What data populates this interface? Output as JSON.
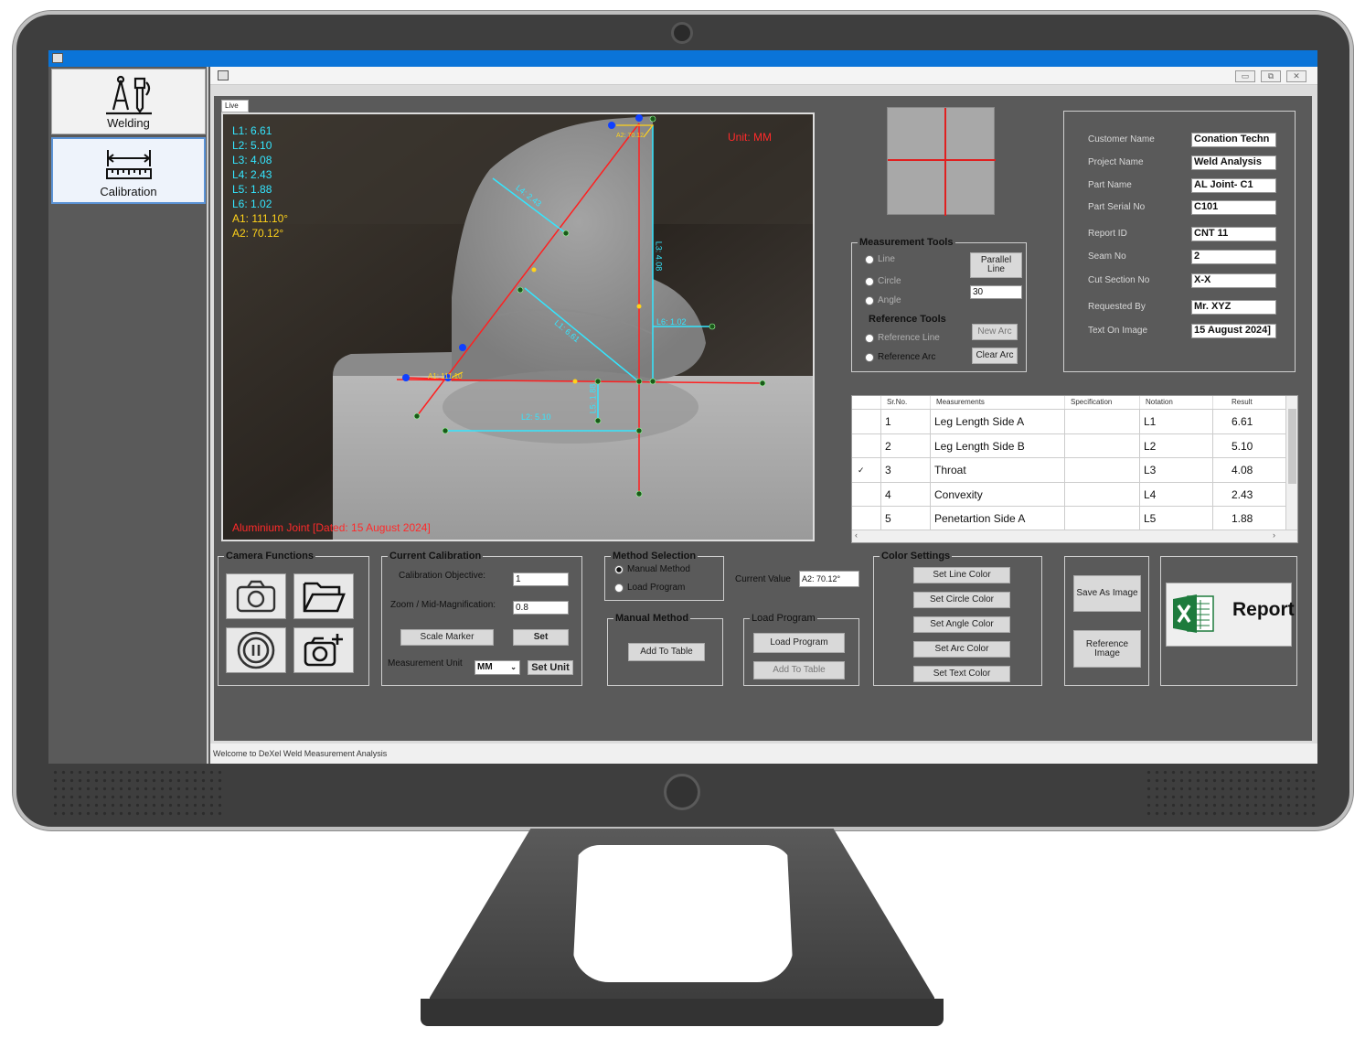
{
  "sidebar": {
    "items": [
      {
        "label": "Welding"
      },
      {
        "label": "Calibration"
      }
    ]
  },
  "window": {
    "live_tab": "Live",
    "status": "Welcome to DeXel Weld Measurement Analysis"
  },
  "live": {
    "measurements": [
      "L1: 6.61",
      "L2: 5.10",
      "L3: 4.08",
      "L4: 2.43",
      "L5: 1.88",
      "L6: 1.02"
    ],
    "angles": [
      "A1: 111.10°",
      "A2: 70.12°"
    ],
    "unit_label": "Unit: MM",
    "caption": "Aluminium Joint [Dated: 15 August 2024]",
    "line_labels": [
      "L4: 2.43",
      "L3: 4.08",
      "L6: 1.02",
      "L2: 5.10",
      "L5: 1.88",
      "A1: 111.10",
      "A2: 70.12",
      "L1: 6.61"
    ]
  },
  "measurement_tools": {
    "title": "Measurement Tools",
    "line": "Line",
    "circle": "Circle",
    "angle": "Angle",
    "parallel_line": "Parallel Line",
    "parallel_value": "30",
    "reference_title": "Reference Tools",
    "reference_line": "Reference Line",
    "reference_arc": "Reference Arc",
    "new_arc": "New Arc",
    "clear_arc": "Clear Arc"
  },
  "info": {
    "fields": [
      {
        "label": "Customer Name",
        "value": "Conation Techn"
      },
      {
        "label": "Project Name",
        "value": "Weld Analysis"
      },
      {
        "label": "Part Name",
        "value": "AL Joint- C1"
      },
      {
        "label": "Part Serial No",
        "value": "C101"
      },
      {
        "label": "Report ID",
        "value": "CNT 11"
      },
      {
        "label": "Seam No",
        "value": "2"
      },
      {
        "label": "Cut Section No",
        "value": "X-X"
      },
      {
        "label": "Requested By",
        "value": "Mr. XYZ"
      },
      {
        "label": "Text On Image",
        "value": "15 August 2024]"
      }
    ]
  },
  "table": {
    "headers": [
      "Sr.No.",
      "Measurements",
      "Specification",
      "Notation",
      "Result"
    ],
    "rows": [
      {
        "sr": "1",
        "name": "Leg Length Side A",
        "spec": "",
        "notation": "L1",
        "result": "6.61"
      },
      {
        "sr": "2",
        "name": "Leg Length Side B",
        "spec": "",
        "notation": "L2",
        "result": "5.10"
      },
      {
        "sr": "3",
        "name": "Throat",
        "spec": "",
        "notation": "L3",
        "result": "4.08"
      },
      {
        "sr": "4",
        "name": "Convexity",
        "spec": "",
        "notation": "L4",
        "result": "2.43"
      },
      {
        "sr": "5",
        "name": "Penetartion Side A",
        "spec": "",
        "notation": "L5",
        "result": "1.88"
      }
    ]
  },
  "camera": {
    "title": "Camera Functions"
  },
  "calibration": {
    "title": "Current Calibration",
    "objective_label": "Calibration Objective:",
    "objective_value": "1",
    "zoom_label": "Zoom / Mid-Magnification:",
    "zoom_value": "0.8",
    "scale_marker": "Scale Marker",
    "set": "Set",
    "unit_label": "Measurement Unit",
    "unit_value": "MM",
    "set_unit": "Set Unit"
  },
  "method": {
    "title": "Method Selection",
    "manual": "Manual Method",
    "load": "Load Program",
    "current_value_label": "Current Value",
    "current_value": "A2: 70.12°"
  },
  "manual_method": {
    "title": "Manual Method",
    "add_to_table": "Add To Table"
  },
  "load_program": {
    "title": "Load Program",
    "load": "Load Program",
    "add_to_table": "Add To Table"
  },
  "color_settings": {
    "title": "Color Settings",
    "buttons": [
      "Set Line Color",
      "Set Circle Color",
      "Set Angle Color",
      "Set Arc Color",
      "Set Text Color"
    ]
  },
  "actions": {
    "save_as_image": "Save As Image",
    "reference_image": "Reference Image",
    "report": "Report"
  }
}
